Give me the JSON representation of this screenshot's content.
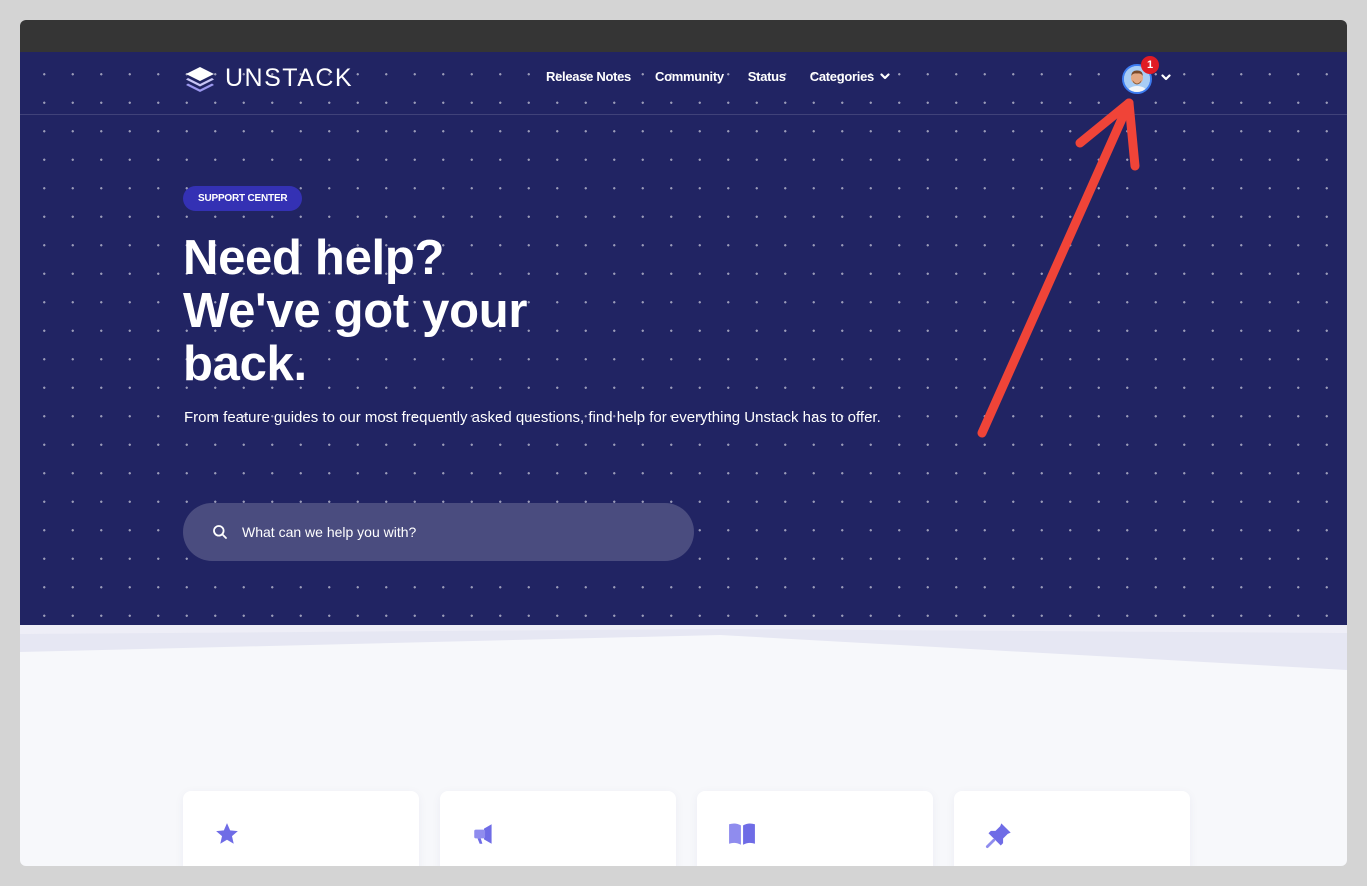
{
  "brand": {
    "name": "UNSTACK",
    "logo_icon": "stack-layers-icon"
  },
  "nav": {
    "items": [
      {
        "label": "Release Notes",
        "icon": null
      },
      {
        "label": "Community",
        "icon": null
      },
      {
        "label": "Status",
        "icon": null
      },
      {
        "label": "Categories",
        "icon": "chevron-down-icon"
      }
    ]
  },
  "user": {
    "notification_count": "1",
    "avatar_icon": "user-avatar",
    "menu_icon": "chevron-down-icon"
  },
  "hero": {
    "badge": "SUPPORT CENTER",
    "title_lines": [
      "Need help?",
      "We've got your",
      "back."
    ],
    "subtitle": "From feature guides to our most frequently asked questions, find help for everything Unstack has to offer."
  },
  "search": {
    "placeholder": "What can we help you with?",
    "value": "",
    "icon": "search-icon"
  },
  "cards": [
    {
      "icon": "star-icon"
    },
    {
      "icon": "megaphone-icon"
    },
    {
      "icon": "book-icon"
    },
    {
      "icon": "pushpin-icon"
    }
  ],
  "annotation": {
    "type": "arrow",
    "color": "#f04438",
    "target": "user-avatar"
  },
  "colors": {
    "hero_bg": "#212463",
    "badge_bg": "#3431b4",
    "accent_icon": "#6f6ce6",
    "notification": "#e01b24"
  }
}
